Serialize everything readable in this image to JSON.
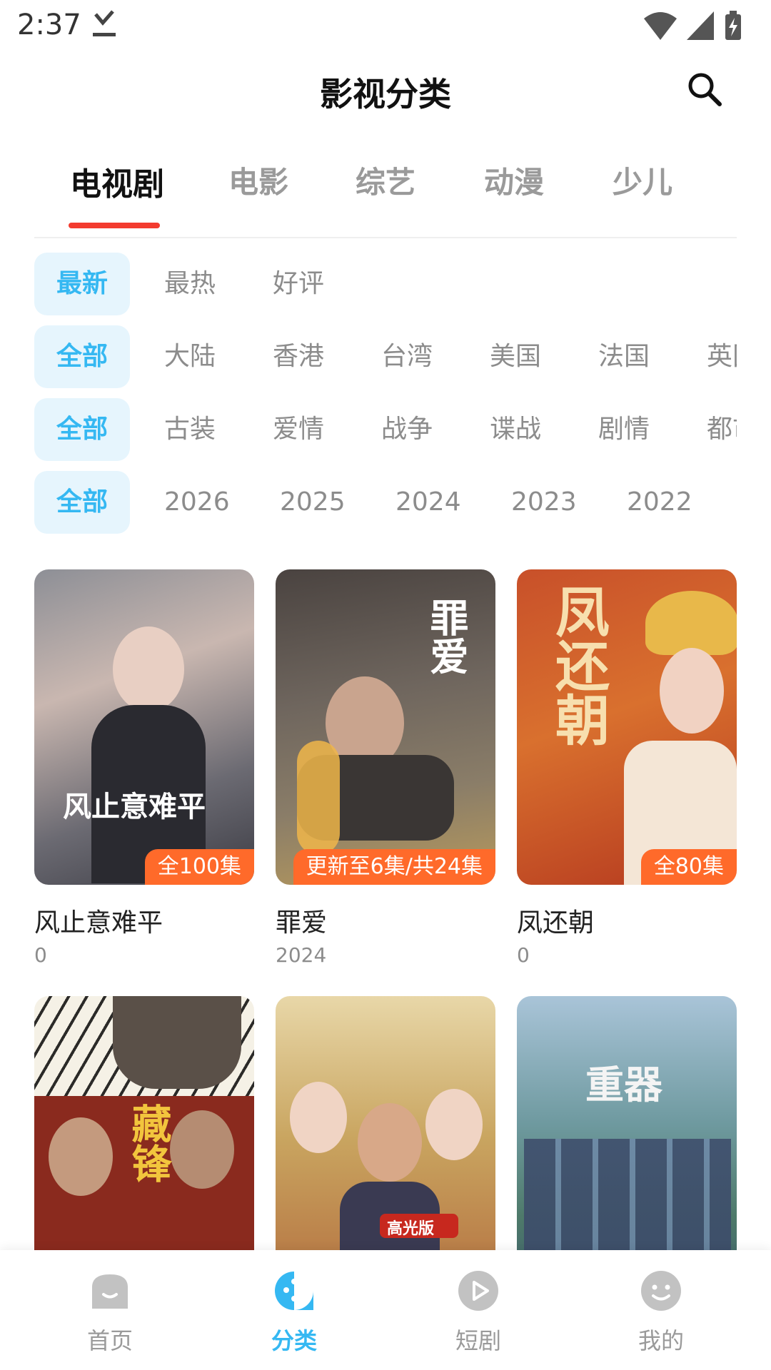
{
  "status": {
    "time": "2:37"
  },
  "header": {
    "title": "影视分类"
  },
  "tabs": [
    {
      "label": "电视剧"
    },
    {
      "label": "电影"
    },
    {
      "label": "综艺"
    },
    {
      "label": "动漫"
    },
    {
      "label": "少儿"
    }
  ],
  "filters": {
    "sort": [
      "最新",
      "最热",
      "好评"
    ],
    "region": [
      "全部",
      "大陆",
      "香港",
      "台湾",
      "美国",
      "法国",
      "英国"
    ],
    "genre": [
      "全部",
      "古装",
      "爱情",
      "战争",
      "谍战",
      "剧情",
      "都市"
    ],
    "year": [
      "全部",
      "2026",
      "2025",
      "2024",
      "2023",
      "2022"
    ]
  },
  "cards": [
    {
      "title": "风止意难平",
      "sub": "0",
      "badge": "全100集",
      "poster_text": "风止意难平"
    },
    {
      "title": "罪爱",
      "sub": "2024",
      "badge": "更新至6集/共24集",
      "poster_text": "罪爱"
    },
    {
      "title": "凤还朝",
      "sub": "0",
      "badge": "全80集",
      "poster_text": "凤还朝"
    },
    {
      "poster_text": "藏锋"
    },
    {
      "poster_text": "高光版"
    },
    {
      "poster_text": "重器"
    }
  ],
  "nav": [
    {
      "label": "首页"
    },
    {
      "label": "分类"
    },
    {
      "label": "短剧"
    },
    {
      "label": "我的"
    }
  ],
  "colors": {
    "accent": "#35b8f2",
    "tab_indicator": "#f33b2f",
    "badge": "#ff6a2a"
  }
}
